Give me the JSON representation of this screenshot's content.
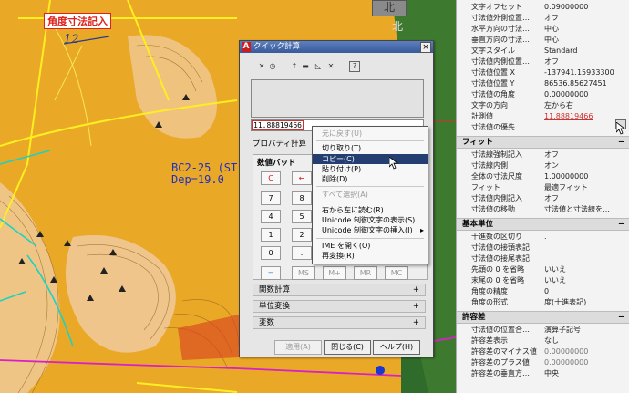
{
  "canvas": {
    "callout": "角度寸法記入",
    "dim_label": "12",
    "station_line1": "BC2-25 (ST",
    "station_line2": "Dep=19.0",
    "north_button": "北",
    "north_text": "北"
  },
  "dialog": {
    "title": "クイック計算",
    "close": "×",
    "toolbar_icons": [
      "clear-icon",
      "history-icon",
      "get-coordinates-icon",
      "distance-icon",
      "angle-icon",
      "intersection-icon",
      "help-icon"
    ],
    "toolbar_glyphs": [
      "✕",
      "◷",
      "↑",
      "▬",
      "◺",
      "✕",
      "?"
    ],
    "input_value": "11.88819466",
    "property_calc": "プロパティ計算",
    "numpad": {
      "header": "数値パッド",
      "keys": [
        {
          "label": "C",
          "style": "red"
        },
        {
          "label": "←",
          "style": "red"
        },
        {
          "label": "7",
          "style": ""
        },
        {
          "label": "8",
          "style": ""
        },
        {
          "label": "4",
          "style": ""
        },
        {
          "label": "5",
          "style": ""
        },
        {
          "label": "1",
          "style": ""
        },
        {
          "label": "2",
          "style": ""
        },
        {
          "label": "0",
          "style": ""
        },
        {
          "label": ".",
          "style": ""
        },
        {
          "label": "=",
          "style": "blue"
        },
        {
          "label": "MS",
          "style": "gray"
        },
        {
          "label": "M+",
          "style": "gray"
        },
        {
          "label": "MR",
          "style": "gray"
        },
        {
          "label": "MC",
          "style": "gray"
        }
      ]
    },
    "sections": [
      "関数計算",
      "単位変換",
      "変数"
    ],
    "expand": "+",
    "buttons": {
      "apply": "適用(A)",
      "close": "閉じる(C)",
      "help": "ヘルプ(H)"
    }
  },
  "context_menu": {
    "items": [
      {
        "label": "元に戻す(U)",
        "state": "disabled"
      },
      {
        "label": "切り取り(T)",
        "state": "normal"
      },
      {
        "label": "コピー(C)",
        "state": "selected"
      },
      {
        "label": "貼り付け(P)",
        "state": "normal"
      },
      {
        "label": "削除(D)",
        "state": "normal"
      },
      {
        "label": "すべて選択(A)",
        "state": "disabled"
      },
      {
        "label": "右から左に読む(R)",
        "state": "normal"
      },
      {
        "label": "Unicode 制御文字の表示(S)",
        "state": "normal"
      },
      {
        "label": "Unicode 制御文字の挿入(I)",
        "state": "normal",
        "submenu": "▸"
      },
      {
        "label": "IME を開く(O)",
        "state": "normal"
      },
      {
        "label": "再変換(R)",
        "state": "normal"
      }
    ]
  },
  "properties": {
    "rows_top": [
      {
        "k": "文字オフセット",
        "v": "0.09000000"
      },
      {
        "k": "寸法値外側位置…",
        "v": "オフ"
      },
      {
        "k": "水平方向の寸法…",
        "v": "中心"
      },
      {
        "k": "垂直方向の寸法…",
        "v": "中心"
      },
      {
        "k": "文字スタイル",
        "v": "Standard"
      },
      {
        "k": "寸法値内側位置…",
        "v": "オフ"
      },
      {
        "k": "寸法値位置 X",
        "v": "-137941.15933300"
      },
      {
        "k": "寸法値位置 Y",
        "v": "86536.85627451"
      },
      {
        "k": "寸法値の角度",
        "v": "0.00000000"
      },
      {
        "k": "文字の方向",
        "v": "左から右"
      },
      {
        "k": "計測値",
        "v": "11.88819466",
        "style": "red"
      },
      {
        "k": "寸法値の優先",
        "v": ""
      }
    ],
    "section_fit": "フィット",
    "rows_fit": [
      {
        "k": "寸法線強制記入",
        "v": "オフ"
      },
      {
        "k": "寸法線内側",
        "v": "オン"
      },
      {
        "k": "全体の寸法尺度",
        "v": "1.00000000"
      },
      {
        "k": "フィット",
        "v": "最適フィット"
      },
      {
        "k": "寸法値内側記入",
        "v": "オフ"
      },
      {
        "k": "寸法値の移動",
        "v": "寸法値と寸法線を…"
      }
    ],
    "section_primary": "基本単位",
    "rows_primary": [
      {
        "k": "十進数の区切り",
        "v": "."
      },
      {
        "k": "寸法値の接頭表記",
        "v": ""
      },
      {
        "k": "寸法値の接尾表記",
        "v": ""
      },
      {
        "k": "先頭の 0 を省略",
        "v": "いいえ"
      },
      {
        "k": "末尾の 0 を省略",
        "v": "いいえ"
      },
      {
        "k": "角度の精度",
        "v": "0"
      },
      {
        "k": "角度の形式",
        "v": "度(十進表記)"
      }
    ],
    "section_tol": "許容差",
    "rows_tol": [
      {
        "k": "寸法値の位置合…",
        "v": "演算子記号"
      },
      {
        "k": "許容差表示",
        "v": "なし"
      },
      {
        "k": "許容差のマイナス値",
        "v": "0.00000000",
        "style": "dim"
      },
      {
        "k": "許容差のプラス値",
        "v": "0.00000000",
        "style": "dim"
      },
      {
        "k": "許容差の垂直方…",
        "v": "中央"
      }
    ],
    "collapse": "−"
  }
}
